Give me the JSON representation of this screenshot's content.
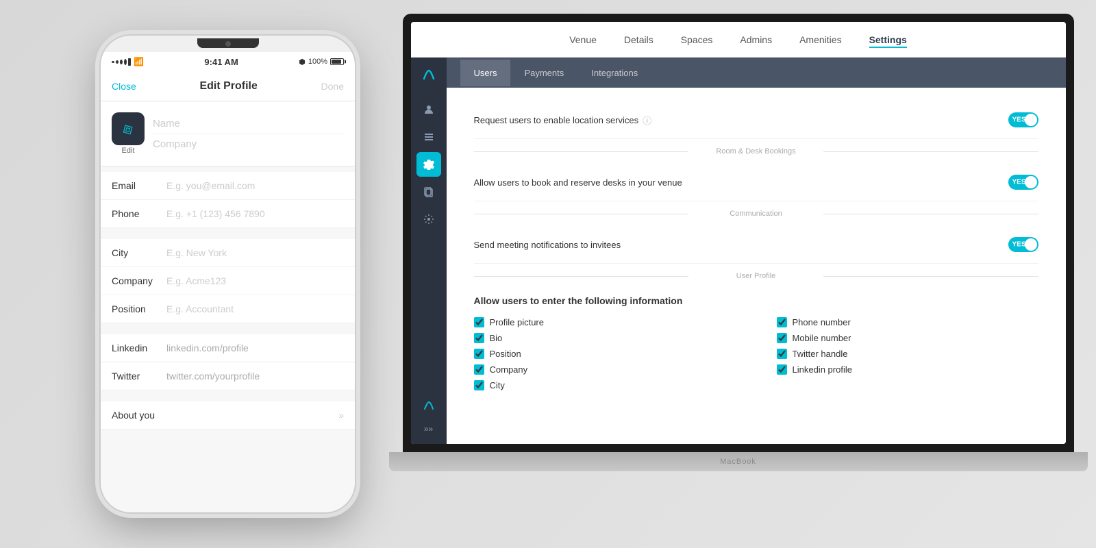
{
  "background": {
    "color": "#e5e5e5"
  },
  "macbook": {
    "label": "MacBook"
  },
  "app": {
    "top_nav": {
      "items": [
        {
          "label": "Venue",
          "active": false
        },
        {
          "label": "Details",
          "active": false
        },
        {
          "label": "Spaces",
          "active": false
        },
        {
          "label": "Admins",
          "active": false
        },
        {
          "label": "Amenities",
          "active": false
        },
        {
          "label": "Settings",
          "active": true
        }
      ]
    },
    "sub_tabs": {
      "items": [
        {
          "label": "Users",
          "active": true
        },
        {
          "label": "Payments",
          "active": false
        },
        {
          "label": "Integrations",
          "active": false
        }
      ]
    },
    "sidebar": {
      "icons": [
        {
          "name": "user-icon",
          "symbol": "👤",
          "active": false
        },
        {
          "name": "list-icon",
          "symbol": "☰",
          "active": false
        },
        {
          "name": "settings-icon",
          "symbol": "⚙",
          "active": true
        },
        {
          "name": "copy-icon",
          "symbol": "⧉",
          "active": false
        },
        {
          "name": "gear-icon",
          "symbol": "⚙",
          "active": false
        }
      ]
    },
    "settings": {
      "location_label": "Request users to enable location services",
      "location_toggle": "YES",
      "room_desk_section": "Room & Desk Bookings",
      "room_desk_label": "Allow users to book and reserve desks in your venue",
      "room_desk_toggle": "YES",
      "communication_section": "Communication",
      "communication_label": "Send meeting notifications to invitees",
      "communication_toggle": "YES",
      "user_profile_section": "User Profile",
      "user_profile_allow_text": "Allow users to enter the following information",
      "checkboxes_left": [
        {
          "label": "Profile picture",
          "checked": true
        },
        {
          "label": "Bio",
          "checked": true
        },
        {
          "label": "Position",
          "checked": true
        },
        {
          "label": "Company",
          "checked": true
        },
        {
          "label": "City",
          "checked": true
        }
      ],
      "checkboxes_right": [
        {
          "label": "Phone number",
          "checked": true
        },
        {
          "label": "Mobile number",
          "checked": true
        },
        {
          "label": "Twitter handle",
          "checked": true
        },
        {
          "label": "Linkedin profile",
          "checked": true
        }
      ]
    }
  },
  "iphone": {
    "status_bar": {
      "dots": 5,
      "wifi": "wifi",
      "time": "9:41 AM",
      "bluetooth": "BT",
      "battery": "100%"
    },
    "header": {
      "close_label": "Close",
      "title": "Edit Profile",
      "done_label": "Done"
    },
    "profile": {
      "edit_label": "Edit",
      "name_placeholder": "Name",
      "company_placeholder": "Company"
    },
    "form_rows": [
      {
        "label": "Email",
        "placeholder": "E.g. you@email.com",
        "has_chevron": false
      },
      {
        "label": "Phone",
        "placeholder": "E.g. +1 (123) 456 7890",
        "has_chevron": false
      },
      {
        "label": "City",
        "placeholder": "E.g. New York",
        "has_chevron": false
      },
      {
        "label": "Company",
        "placeholder": "E.g. Acme123",
        "has_chevron": false
      },
      {
        "label": "Position",
        "placeholder": "E.g. Accountant",
        "has_chevron": false
      }
    ],
    "social_rows": [
      {
        "label": "Linkedin",
        "placeholder": "linkedin.com/profile",
        "has_chevron": false
      },
      {
        "label": "Twitter",
        "placeholder": "twitter.com/yourprofile",
        "has_chevron": false
      }
    ],
    "about_row": {
      "label": "About you",
      "has_chevron": true
    }
  }
}
